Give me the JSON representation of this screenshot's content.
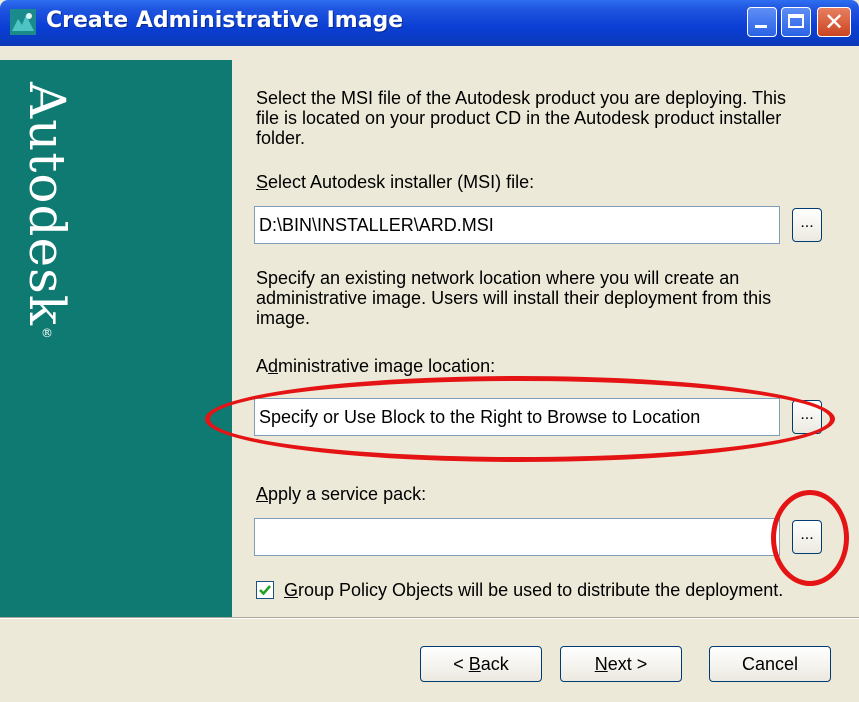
{
  "window": {
    "title": "Create Administrative Image",
    "controls": {
      "minimize": "minimize",
      "maximize": "maximize",
      "close": "✕"
    }
  },
  "brand": {
    "name": "Autodesk",
    "mark": "®"
  },
  "intro": {
    "line1": "Select the MSI file of the Autodesk product you are deploying.  This",
    "line2": "file is located on your product CD in the Autodesk product installer",
    "line3": "folder."
  },
  "msi": {
    "label_accel": "S",
    "label_rest": "elect Autodesk installer (MSI) file:",
    "value": "D:\\BIN\\INSTALLER\\ARD.MSI",
    "browse_label": "..."
  },
  "network": {
    "line1": "Specify an existing network location where you will create an",
    "line2": "administrative image. Users will install their deployment from this",
    "line3": "image."
  },
  "admin_location": {
    "label_pre": "A",
    "label_accel": "d",
    "label_rest": "ministrative image location:",
    "value": "Specify or Use Block to the Right to Browse to Location",
    "browse_label": "..."
  },
  "service_pack": {
    "label_accel": "A",
    "label_rest": "pply a service pack:",
    "value": "",
    "browse_label": "..."
  },
  "gpo": {
    "checked": true,
    "label_accel": "G",
    "label_rest": "roup Policy Objects will be used to distribute the deployment."
  },
  "buttons": {
    "back_arrow": "< ",
    "back_accel": "B",
    "back_rest": "ack",
    "next_accel": "N",
    "next_rest": "ext >",
    "cancel": "Cancel"
  },
  "colors": {
    "brand_panel": "#0e7a72",
    "titlebar": "#0a3ed4",
    "annotation": "#e41414",
    "dialog_bg": "#ece9d8"
  }
}
